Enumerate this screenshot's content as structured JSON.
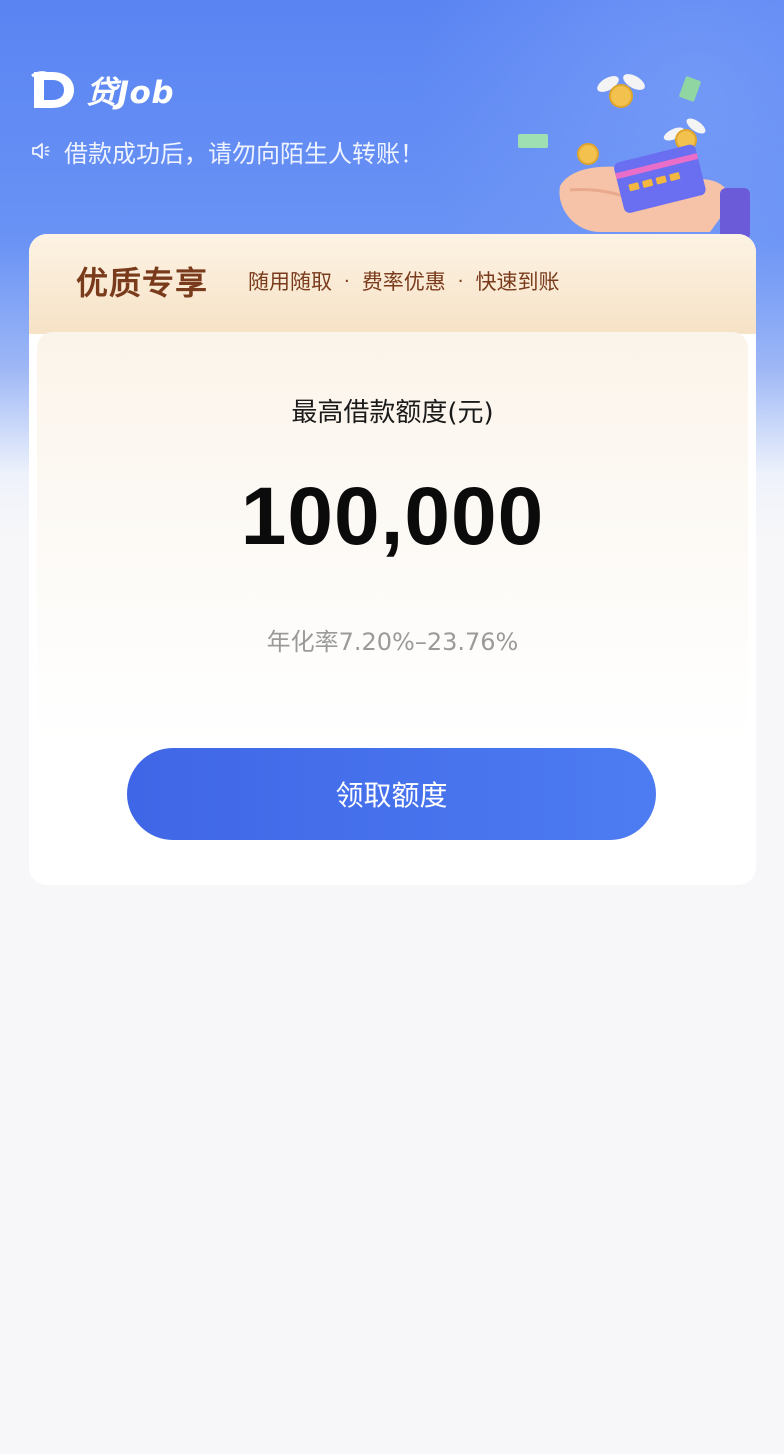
{
  "header": {
    "brand": "贷Job",
    "notice": "借款成功后，请勿向陌生人转账！"
  },
  "card": {
    "title": "优质专享",
    "tags": [
      "随用随取",
      "费率优惠",
      "快速到账"
    ],
    "tag_separator": "·",
    "limit_label": "最高借款额度(元)",
    "limit_amount": "100,000",
    "rate_text": "年化率7.20%–23.76%",
    "button_label": "领取额度"
  },
  "colors": {
    "primary": "#4a72ee",
    "header_brown": "#7a3b1c",
    "page_bg": "#f7f7f9"
  },
  "icons": {
    "logo": "d-logo-icon",
    "notice": "speaker-icon",
    "illustration": "hand-card-coins-illustration"
  }
}
